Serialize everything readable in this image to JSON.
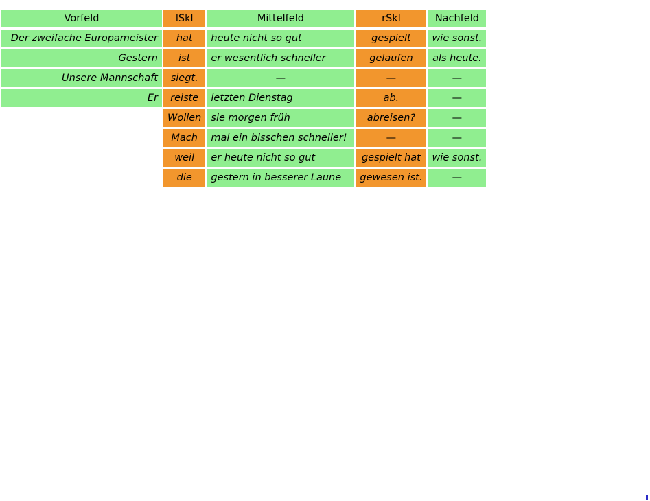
{
  "table": {
    "name": "topological-field-model",
    "columns": [
      {
        "key": "vorfeld",
        "label": "Vorfeld",
        "color": "green",
        "bold": true,
        "align": "right"
      },
      {
        "key": "lskl",
        "label": "lSkl",
        "color": "orange",
        "bold": false,
        "align": "center"
      },
      {
        "key": "mittelfeld",
        "label": "Mittelfeld",
        "color": "green",
        "bold": true,
        "align": "left"
      },
      {
        "key": "rskl",
        "label": "rSkl",
        "color": "orange",
        "bold": false,
        "align": "center"
      },
      {
        "key": "nachfeld",
        "label": "Nachfeld",
        "color": "green",
        "bold": true,
        "align": "center"
      }
    ],
    "dash": "—",
    "rows": [
      {
        "vorfeld": "Der zweifache Europameister",
        "lskl": "hat",
        "mittelfeld": "heute nicht so gut",
        "rskl": "gespielt",
        "nachfeld": "wie sonst."
      },
      {
        "vorfeld": "Gestern",
        "lskl": "ist",
        "mittelfeld": "er wesentlich schneller",
        "rskl": "gelaufen",
        "nachfeld": "als heute."
      },
      {
        "vorfeld": "Unsere Mannschaft",
        "lskl": "siegt.",
        "mittelfeld": "—",
        "rskl": "—",
        "nachfeld": "—"
      },
      {
        "vorfeld": "Er",
        "lskl": "reiste",
        "mittelfeld": "letzten Dienstag",
        "rskl": "ab.",
        "nachfeld": "—"
      },
      {
        "vorfeld": "",
        "lskl": "Wollen",
        "mittelfeld": "sie morgen früh",
        "rskl": "abreisen?",
        "nachfeld": "—"
      },
      {
        "vorfeld": "",
        "lskl": "Mach",
        "mittelfeld": "mal ein bisschen schneller!",
        "rskl": "—",
        "nachfeld": "—"
      },
      {
        "vorfeld": "",
        "lskl": "weil",
        "mittelfeld": "er heute nicht so gut",
        "rskl": "gespielt hat",
        "nachfeld": "wie sonst."
      },
      {
        "vorfeld": "",
        "lskl": "die",
        "mittelfeld": "gestern in besserer Laune",
        "rskl": "gewesen ist.",
        "nachfeld": "—"
      }
    ]
  },
  "colors": {
    "green": "#90ee90",
    "orange": "#f2962d",
    "text": "#000000",
    "background": "#ffffff",
    "artifact": "#2b2bc8"
  }
}
